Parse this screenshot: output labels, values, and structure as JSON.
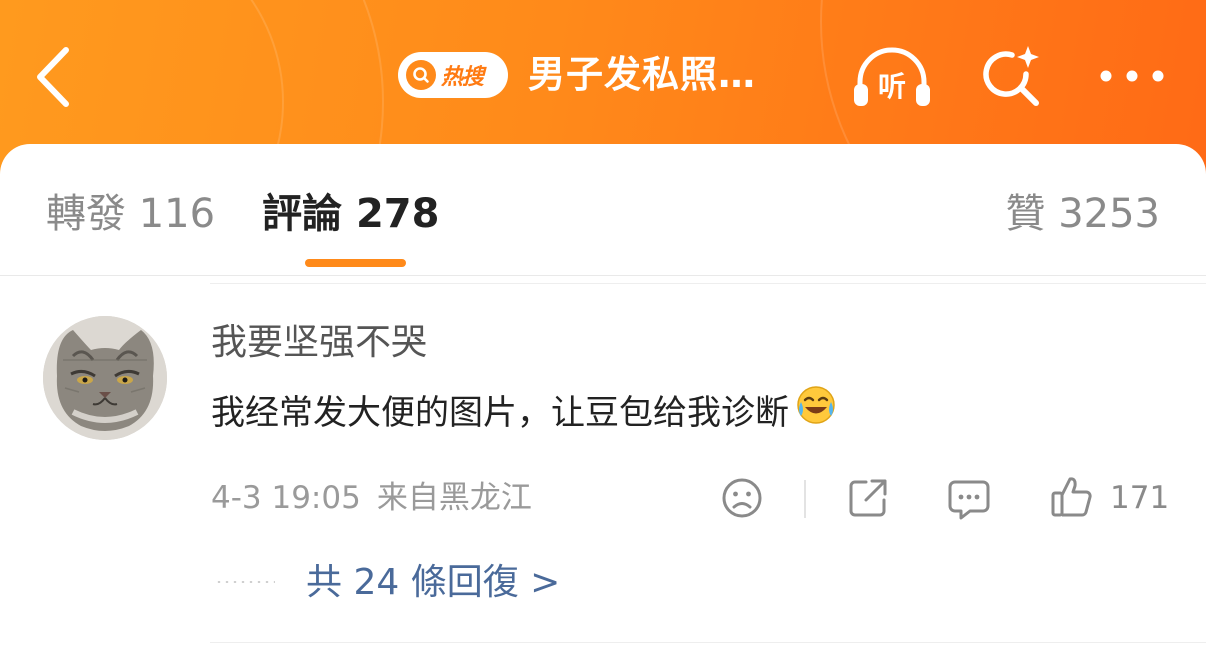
{
  "header": {
    "hot_search_badge": "热搜",
    "title": "男子发私照…",
    "listen_label": "听",
    "accent_color": "#ff8a1a"
  },
  "tabs": {
    "repost": {
      "label": "轉發",
      "count": "116"
    },
    "comments": {
      "label": "評論",
      "count": "278"
    },
    "likes": {
      "label": "贊",
      "count": "3253"
    }
  },
  "comment": {
    "username": "我要坚强不哭",
    "text": "我经常发大便的图片，让豆包给我诊断",
    "emoji": "crying-laughing-emoji",
    "time": "4-3 19:05",
    "location": "来自黑龙江",
    "like_count": "171",
    "replies_link": "共 24 條回復 >"
  },
  "icons": {
    "back": "back-arrow-icon",
    "listen": "headphones-icon",
    "search": "sparkle-search-icon",
    "more": "more-icon",
    "dislike": "sad-face-icon",
    "share": "share-icon",
    "reply": "comment-icon",
    "like": "thumbs-up-icon"
  }
}
